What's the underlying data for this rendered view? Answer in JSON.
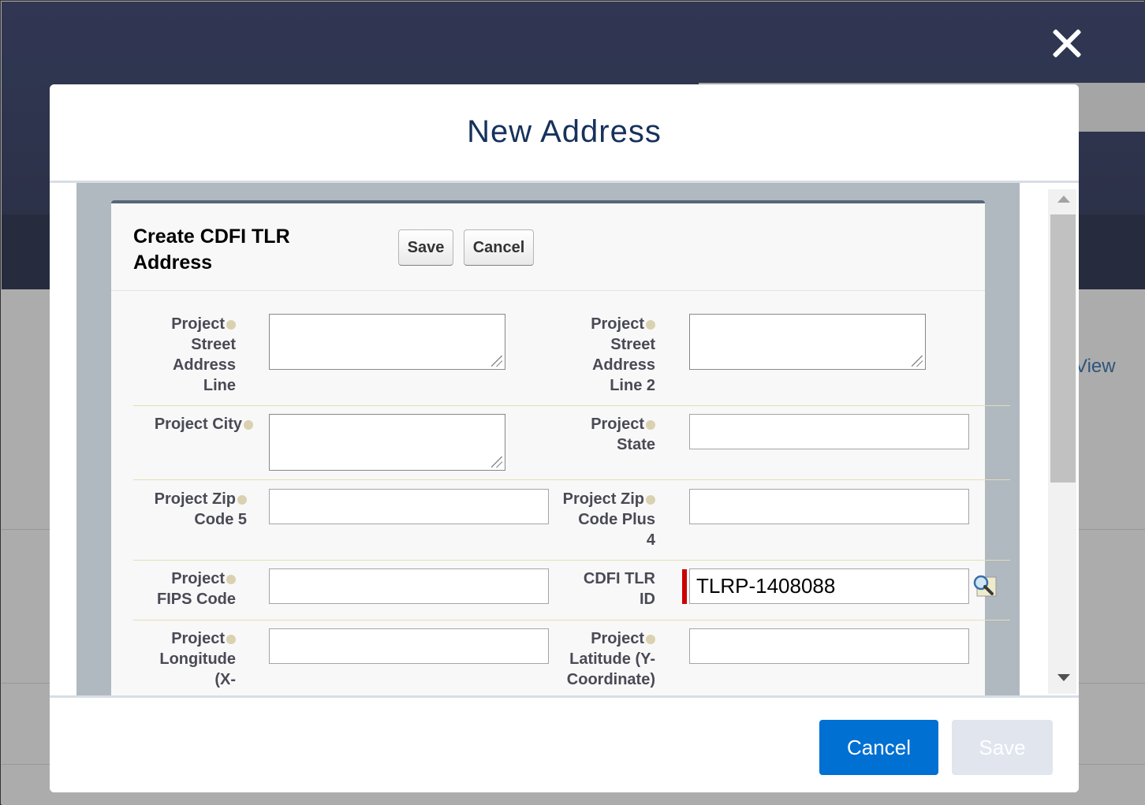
{
  "background": {
    "view_link": "View"
  },
  "modal": {
    "title": "New Address",
    "footer": {
      "cancel_label": "Cancel",
      "save_label": "Save"
    }
  },
  "form": {
    "title": "Create CDFI TLR Address",
    "save_label": "Save",
    "cancel_label": "Cancel",
    "fields": {
      "street1": {
        "label": "Project Street Address Line",
        "value": ""
      },
      "street2": {
        "label": "Project Street Address Line 2",
        "value": ""
      },
      "city": {
        "label": "Project City",
        "value": ""
      },
      "state": {
        "label": "Project State",
        "value": ""
      },
      "zip5": {
        "label": "Project Zip Code 5",
        "value": ""
      },
      "zip4": {
        "label": "Project Zip Code Plus 4",
        "value": ""
      },
      "fips": {
        "label": "Project FIPS Code",
        "value": ""
      },
      "tlr_id": {
        "label": "CDFI TLR ID",
        "value": "TLRP-1408088"
      },
      "longitude": {
        "label": "Project Longitude (X-",
        "value": ""
      },
      "latitude": {
        "label": "Project Latitude (Y-Coordinate)",
        "value": ""
      }
    }
  },
  "colors": {
    "primary_button": "#0070d2",
    "required_marker": "#cc0000",
    "title_text": "#16325c"
  }
}
